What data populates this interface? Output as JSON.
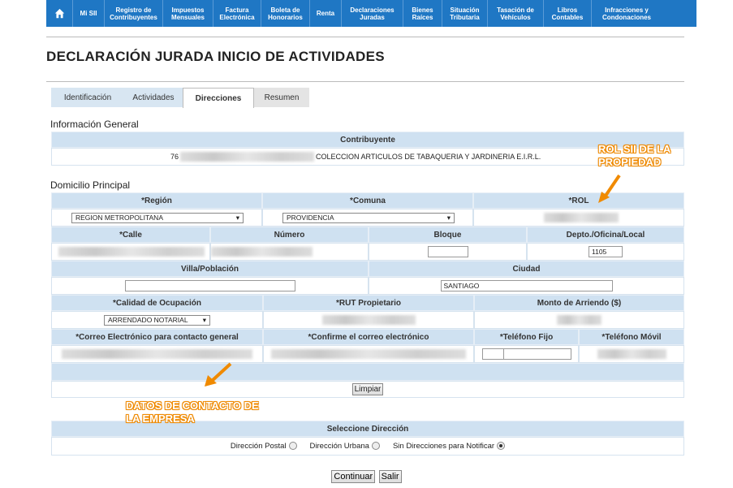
{
  "nav": {
    "items": [
      {
        "label": "Mi SII"
      },
      {
        "label": "Registro de\nContribuyentes"
      },
      {
        "label": "Impuestos\nMensuales"
      },
      {
        "label": "Factura\nElectrónica"
      },
      {
        "label": "Boleta de\nHonorarios"
      },
      {
        "label": "Renta"
      },
      {
        "label": "Declaraciones\nJuradas"
      },
      {
        "label": "Bienes\nRaíces"
      },
      {
        "label": "Situación\nTributaria"
      },
      {
        "label": "Tasación de\nVehículos"
      },
      {
        "label": "Libros\nContables"
      },
      {
        "label": "Infracciones y\nCondonaciones"
      }
    ],
    "home_icon": "home-icon"
  },
  "page_title": "DECLARACIÓN JURADA INICIO DE ACTIVIDADES",
  "tabs": [
    {
      "label": "Identificación"
    },
    {
      "label": "Actividades"
    },
    {
      "label": "Direcciones"
    },
    {
      "label": "Resumen"
    }
  ],
  "info": {
    "title": "Información General",
    "contribuyente_header": "Contribuyente",
    "rut_prefix": "76",
    "company_name": "COLECCION ARTICULOS DE TABAQUERIA Y JARDINERIA E.I.R.L."
  },
  "domicilio": {
    "title": "Domicilio Principal",
    "region_label": "*Región",
    "comuna_label": "*Comuna",
    "rol_label": "*ROL",
    "region_value": "REGION METROPOLITANA",
    "comuna_value": "PROVIDENCIA",
    "calle_label": "*Calle",
    "numero_label": "Número",
    "bloque_label": "Bloque",
    "depto_label": "Depto./Oficina/Local",
    "depto_value": "1105",
    "villa_label": "Villa/Población",
    "ciudad_label": "Ciudad",
    "ciudad_value": "SANTIAGO",
    "calidad_label": "*Calidad de Ocupación",
    "rut_prop_label": "*RUT Propietario",
    "monto_label": "Monto de Arriendo ($)",
    "calidad_value": "ARRENDADO NOTARIAL",
    "correo_label": "*Correo Electrónico para contacto general",
    "confirme_label": "*Confirme el correo electrónico",
    "tel_fijo_label": "*Teléfono Fijo",
    "tel_movil_label": "*Teléfono Móvil",
    "limpiar": "Limpiar"
  },
  "seleccione": {
    "header": "Seleccione Dirección",
    "options": [
      {
        "label": "Dirección Postal",
        "selected": false
      },
      {
        "label": "Dirección Urbana",
        "selected": false
      },
      {
        "label": "Sin Direcciones para Notificar",
        "selected": true
      }
    ]
  },
  "buttons": {
    "continuar": "Continuar",
    "salir": "Salir"
  },
  "annotations": {
    "rol": "ROL SII DE LA\nPROPIEDAD",
    "contacto": "DATOS DE CONTACTO DE\nLA EMPRESA"
  },
  "colors": {
    "nav": "#1f77c4",
    "header": "#cfe1f1",
    "annotation": "#f08a00"
  }
}
